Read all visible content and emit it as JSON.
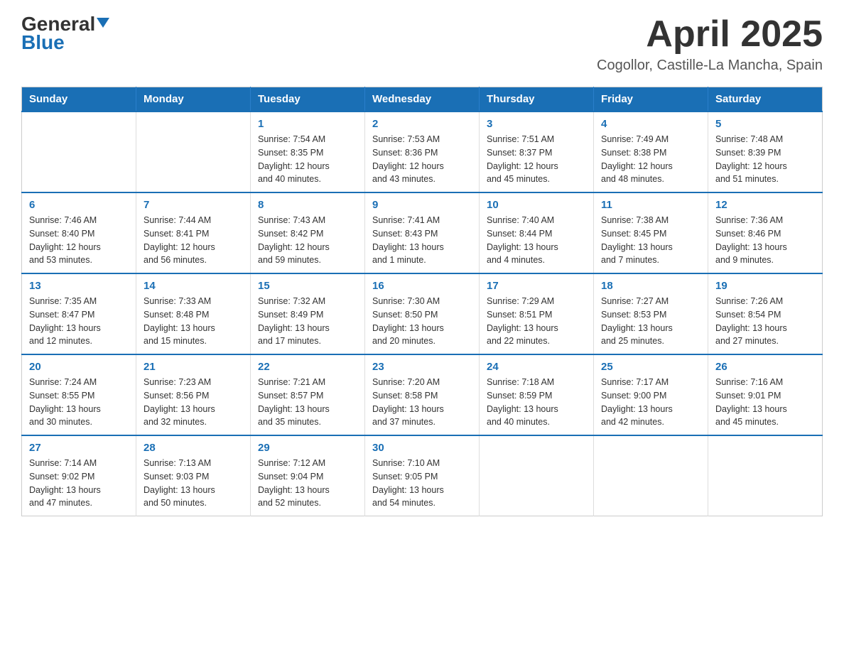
{
  "header": {
    "logo_line1": "General",
    "logo_line2": "Blue",
    "month": "April 2025",
    "location": "Cogollor, Castille-La Mancha, Spain"
  },
  "weekdays": [
    "Sunday",
    "Monday",
    "Tuesday",
    "Wednesday",
    "Thursday",
    "Friday",
    "Saturday"
  ],
  "weeks": [
    [
      {
        "day": "",
        "info": ""
      },
      {
        "day": "",
        "info": ""
      },
      {
        "day": "1",
        "info": "Sunrise: 7:54 AM\nSunset: 8:35 PM\nDaylight: 12 hours\nand 40 minutes."
      },
      {
        "day": "2",
        "info": "Sunrise: 7:53 AM\nSunset: 8:36 PM\nDaylight: 12 hours\nand 43 minutes."
      },
      {
        "day": "3",
        "info": "Sunrise: 7:51 AM\nSunset: 8:37 PM\nDaylight: 12 hours\nand 45 minutes."
      },
      {
        "day": "4",
        "info": "Sunrise: 7:49 AM\nSunset: 8:38 PM\nDaylight: 12 hours\nand 48 minutes."
      },
      {
        "day": "5",
        "info": "Sunrise: 7:48 AM\nSunset: 8:39 PM\nDaylight: 12 hours\nand 51 minutes."
      }
    ],
    [
      {
        "day": "6",
        "info": "Sunrise: 7:46 AM\nSunset: 8:40 PM\nDaylight: 12 hours\nand 53 minutes."
      },
      {
        "day": "7",
        "info": "Sunrise: 7:44 AM\nSunset: 8:41 PM\nDaylight: 12 hours\nand 56 minutes."
      },
      {
        "day": "8",
        "info": "Sunrise: 7:43 AM\nSunset: 8:42 PM\nDaylight: 12 hours\nand 59 minutes."
      },
      {
        "day": "9",
        "info": "Sunrise: 7:41 AM\nSunset: 8:43 PM\nDaylight: 13 hours\nand 1 minute."
      },
      {
        "day": "10",
        "info": "Sunrise: 7:40 AM\nSunset: 8:44 PM\nDaylight: 13 hours\nand 4 minutes."
      },
      {
        "day": "11",
        "info": "Sunrise: 7:38 AM\nSunset: 8:45 PM\nDaylight: 13 hours\nand 7 minutes."
      },
      {
        "day": "12",
        "info": "Sunrise: 7:36 AM\nSunset: 8:46 PM\nDaylight: 13 hours\nand 9 minutes."
      }
    ],
    [
      {
        "day": "13",
        "info": "Sunrise: 7:35 AM\nSunset: 8:47 PM\nDaylight: 13 hours\nand 12 minutes."
      },
      {
        "day": "14",
        "info": "Sunrise: 7:33 AM\nSunset: 8:48 PM\nDaylight: 13 hours\nand 15 minutes."
      },
      {
        "day": "15",
        "info": "Sunrise: 7:32 AM\nSunset: 8:49 PM\nDaylight: 13 hours\nand 17 minutes."
      },
      {
        "day": "16",
        "info": "Sunrise: 7:30 AM\nSunset: 8:50 PM\nDaylight: 13 hours\nand 20 minutes."
      },
      {
        "day": "17",
        "info": "Sunrise: 7:29 AM\nSunset: 8:51 PM\nDaylight: 13 hours\nand 22 minutes."
      },
      {
        "day": "18",
        "info": "Sunrise: 7:27 AM\nSunset: 8:53 PM\nDaylight: 13 hours\nand 25 minutes."
      },
      {
        "day": "19",
        "info": "Sunrise: 7:26 AM\nSunset: 8:54 PM\nDaylight: 13 hours\nand 27 minutes."
      }
    ],
    [
      {
        "day": "20",
        "info": "Sunrise: 7:24 AM\nSunset: 8:55 PM\nDaylight: 13 hours\nand 30 minutes."
      },
      {
        "day": "21",
        "info": "Sunrise: 7:23 AM\nSunset: 8:56 PM\nDaylight: 13 hours\nand 32 minutes."
      },
      {
        "day": "22",
        "info": "Sunrise: 7:21 AM\nSunset: 8:57 PM\nDaylight: 13 hours\nand 35 minutes."
      },
      {
        "day": "23",
        "info": "Sunrise: 7:20 AM\nSunset: 8:58 PM\nDaylight: 13 hours\nand 37 minutes."
      },
      {
        "day": "24",
        "info": "Sunrise: 7:18 AM\nSunset: 8:59 PM\nDaylight: 13 hours\nand 40 minutes."
      },
      {
        "day": "25",
        "info": "Sunrise: 7:17 AM\nSunset: 9:00 PM\nDaylight: 13 hours\nand 42 minutes."
      },
      {
        "day": "26",
        "info": "Sunrise: 7:16 AM\nSunset: 9:01 PM\nDaylight: 13 hours\nand 45 minutes."
      }
    ],
    [
      {
        "day": "27",
        "info": "Sunrise: 7:14 AM\nSunset: 9:02 PM\nDaylight: 13 hours\nand 47 minutes."
      },
      {
        "day": "28",
        "info": "Sunrise: 7:13 AM\nSunset: 9:03 PM\nDaylight: 13 hours\nand 50 minutes."
      },
      {
        "day": "29",
        "info": "Sunrise: 7:12 AM\nSunset: 9:04 PM\nDaylight: 13 hours\nand 52 minutes."
      },
      {
        "day": "30",
        "info": "Sunrise: 7:10 AM\nSunset: 9:05 PM\nDaylight: 13 hours\nand 54 minutes."
      },
      {
        "day": "",
        "info": ""
      },
      {
        "day": "",
        "info": ""
      },
      {
        "day": "",
        "info": ""
      }
    ]
  ]
}
